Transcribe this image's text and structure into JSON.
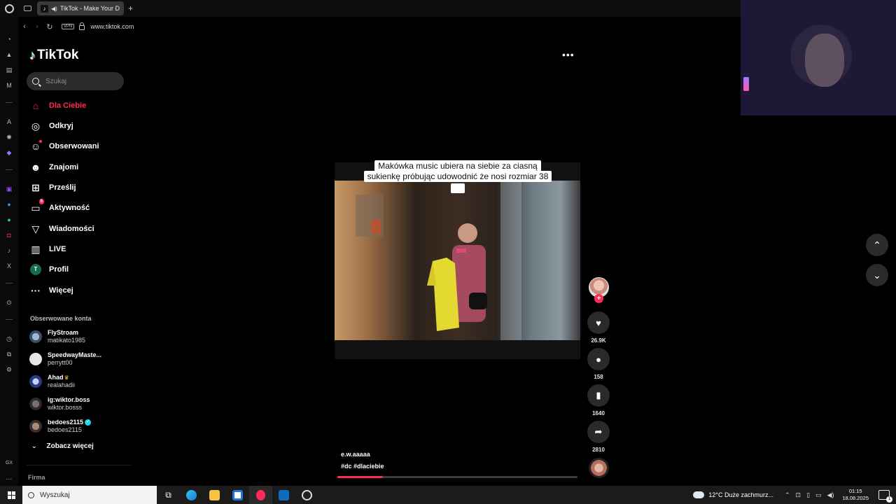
{
  "browser": {
    "tab_title": "TikTok - Make Your D",
    "new_tab_label": "+",
    "url": "www.tiktok.com",
    "vpn_label": "VPN"
  },
  "tiktok": {
    "logo_text": "TikTok",
    "search_placeholder": "Szukaj",
    "nav": [
      {
        "label": "Dla Ciebie",
        "icon": "home-icon",
        "active": true
      },
      {
        "label": "Odkryj",
        "icon": "compass-icon"
      },
      {
        "label": "Obserwowani",
        "icon": "following-icon"
      },
      {
        "label": "Znajomi",
        "icon": "friends-icon"
      },
      {
        "label": "Prześlij",
        "icon": "upload-icon"
      },
      {
        "label": "Aktywność",
        "icon": "activity-icon",
        "badge": "5"
      },
      {
        "label": "Wiadomości",
        "icon": "messages-icon"
      },
      {
        "label": "LIVE",
        "icon": "live-icon"
      },
      {
        "label": "Profil",
        "icon": "profile-icon",
        "avatar_letter": "T"
      },
      {
        "label": "Więcej",
        "icon": "more-icon"
      }
    ],
    "followed_title": "Obserwowane konta",
    "followed": [
      {
        "name": "FlyStroam",
        "handle": "matikato1985"
      },
      {
        "name": "SpeedwayMaste...",
        "handle": "perrytt00"
      },
      {
        "name": "Ahad",
        "handle": "realahadii"
      },
      {
        "name": "ig:wiktor.boss",
        "handle": "wiktor.bosss"
      },
      {
        "name": "bedoes2115",
        "handle": "bedoes2115"
      }
    ],
    "see_more": "Zobacz więcej",
    "footer_section": "Firma"
  },
  "video": {
    "caption_line1": "Makówka music ubiera na siebie za ciasną",
    "caption_line2": "sukienkę próbując udowodnić że nosi rozmiar 38",
    "caption_emoji": "😍",
    "author": "e.w.aaaaa",
    "tags": "#dc  #dlaciebie",
    "progress": 0.19,
    "likes": "26.9K",
    "comments": "158",
    "saves": "1640",
    "shares": "2810"
  },
  "taskbar": {
    "search_placeholder": "Wyszukaj",
    "weather": "12°C  Duże zachmurz...",
    "time": "01:15",
    "date": "18.08.2025",
    "notification_count": "1"
  },
  "colors": {
    "accent": "#fe2c55",
    "background": "#000000"
  }
}
